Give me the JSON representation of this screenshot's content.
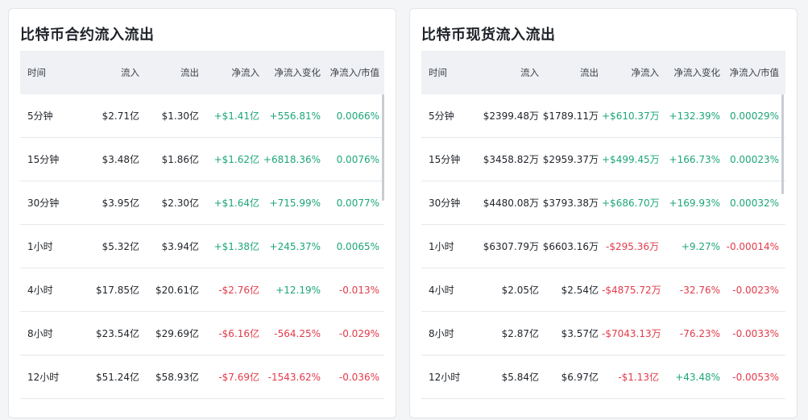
{
  "futures": {
    "title": "比特币合约流入流出",
    "headers": [
      "时间",
      "流入",
      "流出",
      "净流入",
      "净流入变化",
      "净流入/市值"
    ],
    "rows": [
      {
        "period": "5分钟",
        "inflow": "$2.71亿",
        "outflow": "$1.30亿",
        "net": "+$1.41亿",
        "net_change": "+556.81%",
        "net_mcap": "0.0066%",
        "net_sign": "pos",
        "change_sign": "pos",
        "mcap_sign": "pos"
      },
      {
        "period": "15分钟",
        "inflow": "$3.48亿",
        "outflow": "$1.86亿",
        "net": "+$1.62亿",
        "net_change": "+6818.36%",
        "net_mcap": "0.0076%",
        "net_sign": "pos",
        "change_sign": "pos",
        "mcap_sign": "pos"
      },
      {
        "period": "30分钟",
        "inflow": "$3.95亿",
        "outflow": "$2.30亿",
        "net": "+$1.64亿",
        "net_change": "+715.99%",
        "net_mcap": "0.0077%",
        "net_sign": "pos",
        "change_sign": "pos",
        "mcap_sign": "pos"
      },
      {
        "period": "1小时",
        "inflow": "$5.32亿",
        "outflow": "$3.94亿",
        "net": "+$1.38亿",
        "net_change": "+245.37%",
        "net_mcap": "0.0065%",
        "net_sign": "pos",
        "change_sign": "pos",
        "mcap_sign": "pos"
      },
      {
        "period": "4小时",
        "inflow": "$17.85亿",
        "outflow": "$20.61亿",
        "net": "-$2.76亿",
        "net_change": "+12.19%",
        "net_mcap": "-0.013%",
        "net_sign": "neg",
        "change_sign": "pos",
        "mcap_sign": "neg"
      },
      {
        "period": "8小时",
        "inflow": "$23.54亿",
        "outflow": "$29.69亿",
        "net": "-$6.16亿",
        "net_change": "-564.25%",
        "net_mcap": "-0.029%",
        "net_sign": "neg",
        "change_sign": "neg",
        "mcap_sign": "neg"
      },
      {
        "period": "12小时",
        "inflow": "$51.24亿",
        "outflow": "$58.93亿",
        "net": "-$7.69亿",
        "net_change": "-1543.62%",
        "net_mcap": "-0.036%",
        "net_sign": "neg",
        "change_sign": "neg",
        "mcap_sign": "neg"
      }
    ]
  },
  "spot": {
    "title": "比特币现货流入流出",
    "headers": [
      "时间",
      "流入",
      "流出",
      "净流入",
      "净流入变化",
      "净流入/市值"
    ],
    "rows": [
      {
        "period": "5分钟",
        "inflow": "$2399.48万",
        "outflow": "$1789.11万",
        "net": "+$610.37万",
        "net_change": "+132.39%",
        "net_mcap": "0.00029%",
        "net_sign": "pos",
        "change_sign": "pos",
        "mcap_sign": "pos"
      },
      {
        "period": "15分钟",
        "inflow": "$3458.82万",
        "outflow": "$2959.37万",
        "net": "+$499.45万",
        "net_change": "+166.73%",
        "net_mcap": "0.00023%",
        "net_sign": "pos",
        "change_sign": "pos",
        "mcap_sign": "pos"
      },
      {
        "period": "30分钟",
        "inflow": "$4480.08万",
        "outflow": "$3793.38万",
        "net": "+$686.70万",
        "net_change": "+169.93%",
        "net_mcap": "0.00032%",
        "net_sign": "pos",
        "change_sign": "pos",
        "mcap_sign": "pos"
      },
      {
        "period": "1小时",
        "inflow": "$6307.79万",
        "outflow": "$6603.16万",
        "net": "-$295.36万",
        "net_change": "+9.27%",
        "net_mcap": "-0.00014%",
        "net_sign": "neg",
        "change_sign": "pos",
        "mcap_sign": "neg"
      },
      {
        "period": "4小时",
        "inflow": "$2.05亿",
        "outflow": "$2.54亿",
        "net": "-$4875.72万",
        "net_change": "-32.76%",
        "net_mcap": "-0.0023%",
        "net_sign": "neg",
        "change_sign": "neg",
        "mcap_sign": "neg"
      },
      {
        "period": "8小时",
        "inflow": "$2.87亿",
        "outflow": "$3.57亿",
        "net": "-$7043.13万",
        "net_change": "-76.23%",
        "net_mcap": "-0.0033%",
        "net_sign": "neg",
        "change_sign": "neg",
        "mcap_sign": "neg"
      },
      {
        "period": "12小时",
        "inflow": "$5.84亿",
        "outflow": "$6.97亿",
        "net": "-$1.13亿",
        "net_change": "+43.48%",
        "net_mcap": "-0.0053%",
        "net_sign": "neg",
        "change_sign": "pos",
        "mcap_sign": "neg"
      }
    ]
  },
  "colors": {
    "positive": "#1da67a",
    "negative": "#e23b4a",
    "header_bg": "#eff1f4"
  }
}
